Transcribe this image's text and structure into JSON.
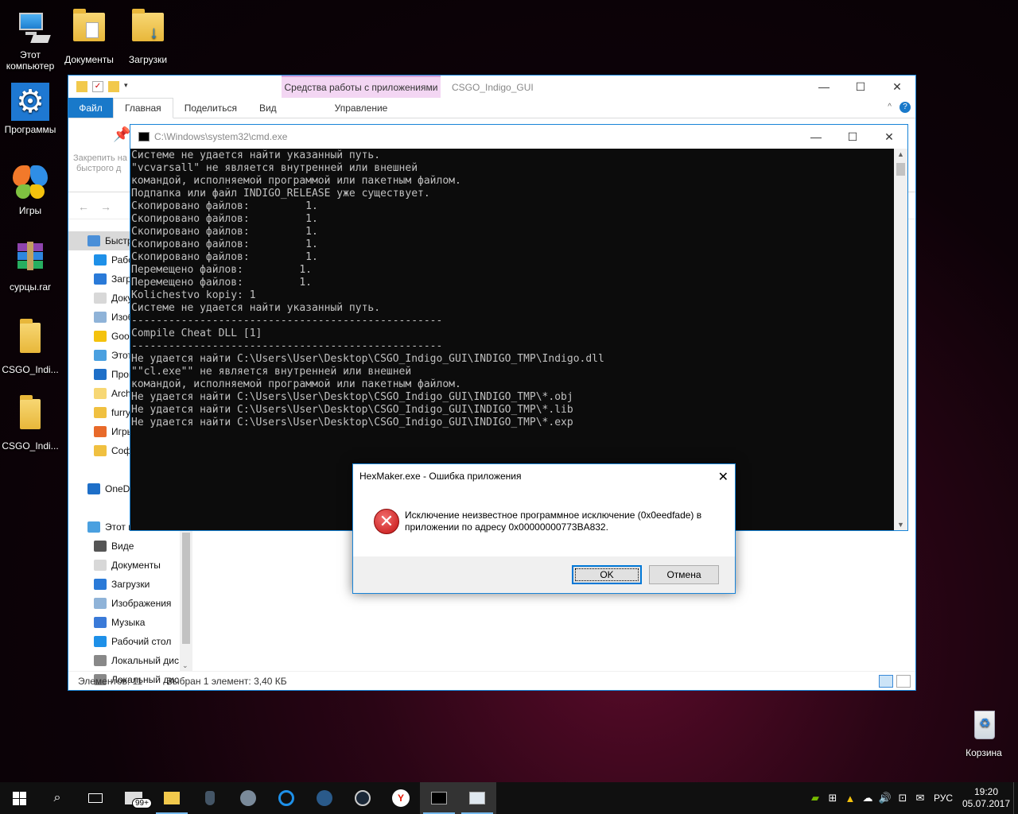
{
  "desktop": {
    "icons": [
      {
        "label": "Этот компьютер"
      },
      {
        "label": "Документы"
      },
      {
        "label": "Загрузки"
      },
      {
        "label": "Программы"
      },
      {
        "label": "Игры"
      },
      {
        "label": "сурцы.rar"
      },
      {
        "label": "CSGO_Indi..."
      },
      {
        "label": "CSGO_Indi..."
      },
      {
        "label": "Корзина"
      }
    ]
  },
  "explorer": {
    "context_tab": "Средства работы с приложениями",
    "title": "CSGO_Indigo_GUI",
    "tabs": {
      "file": "Файл",
      "home": "Главная",
      "share": "Поделиться",
      "view": "Вид",
      "manage": "Управление"
    },
    "pin_label_1": "Закрепить на",
    "pin_label_2": "быстрого д",
    "nav_items": [
      {
        "label": "Быстр",
        "color": "#4a8fd8"
      },
      {
        "label": "Рабо",
        "color": "#1e90e8"
      },
      {
        "label": "Загр",
        "color": "#2a7ad8"
      },
      {
        "label": "Доку",
        "color": "#d8d8d8"
      },
      {
        "label": "Изоб",
        "color": "#8fb3d8"
      },
      {
        "label": "Goog",
        "color": "#f4c20d"
      },
      {
        "label": "Этот",
        "color": "#4aa0e0"
      },
      {
        "label": "Прог",
        "color": "#1e6fc8"
      },
      {
        "label": "Arch",
        "color": "#f7d774"
      },
      {
        "label": "furry",
        "color": "#f0c040"
      },
      {
        "label": "Игры",
        "color": "#e86a2a"
      },
      {
        "label": "Софт",
        "color": "#f0c040"
      },
      {
        "label": "",
        "color": "transparent"
      },
      {
        "label": "OneDr",
        "color": "#1e6fc8"
      },
      {
        "label": "",
        "color": "transparent"
      },
      {
        "label": "Этот к",
        "color": "#4aa0e0"
      },
      {
        "label": "Виде",
        "color": "#555"
      },
      {
        "label": "Документы",
        "color": "#d8d8d8"
      },
      {
        "label": "Загрузки",
        "color": "#2a7ad8"
      },
      {
        "label": "Изображения",
        "color": "#8fb3d8"
      },
      {
        "label": "Музыка",
        "color": "#3a7ad8"
      },
      {
        "label": "Рабочий стол",
        "color": "#1e90e8"
      },
      {
        "label": "Локальный дис",
        "color": "#888"
      },
      {
        "label": "Локальный дис",
        "color": "#888"
      }
    ],
    "status_items": "Элементов: 11",
    "status_selected": "Выбран 1 элемент: 3,40 КБ"
  },
  "cmd": {
    "title": "C:\\Windows\\system32\\cmd.exe",
    "output": "Системе не удается найти указанный путь.\n\"vcvarsall\" не является внутренней или внешней\nкомандой, исполняемой программой или пакетным файлом.\nПодпапка или файл INDIGO_RELEASE уже существует.\nСкопировано файлов:         1.\nСкопировано файлов:         1.\nСкопировано файлов:         1.\nСкопировано файлов:         1.\nСкопировано файлов:         1.\nПеремещено файлов:         1.\nПеремещено файлов:         1.\nKolichestvo kopiy: 1\nСистеме не удается найти указанный путь.\n--------------------------------------------------\nCompile Cheat DLL [1]\n--------------------------------------------------\nНе удается найти C:\\Users\\User\\Desktop\\CSGO_Indigo_GUI\\INDIGO_TMP\\Indigo.dll\n\"\"cl.exe\"\" не является внутренней или внешней\nкомандой, исполняемой программой или пакетным файлом.\nНе удается найти C:\\Users\\User\\Desktop\\CSGO_Indigo_GUI\\INDIGO_TMP\\*.obj\nНе удается найти C:\\Users\\User\\Desktop\\CSGO_Indigo_GUI\\INDIGO_TMP\\*.lib\nНе удается найти C:\\Users\\User\\Desktop\\CSGO_Indigo_GUI\\INDIGO_TMP\\*.exp"
  },
  "dialog": {
    "title": "HexMaker.exe - Ошибка приложения",
    "message": "Исключение неизвестное программное исключение (0x0eedfade) в приложении по адресу 0x00000000773BA832.",
    "ok_label": "OK",
    "cancel_label": "Отмена"
  },
  "taskbar": {
    "badge": "99+",
    "language": "РУС",
    "time": "19:20",
    "date": "05.07.2017"
  }
}
